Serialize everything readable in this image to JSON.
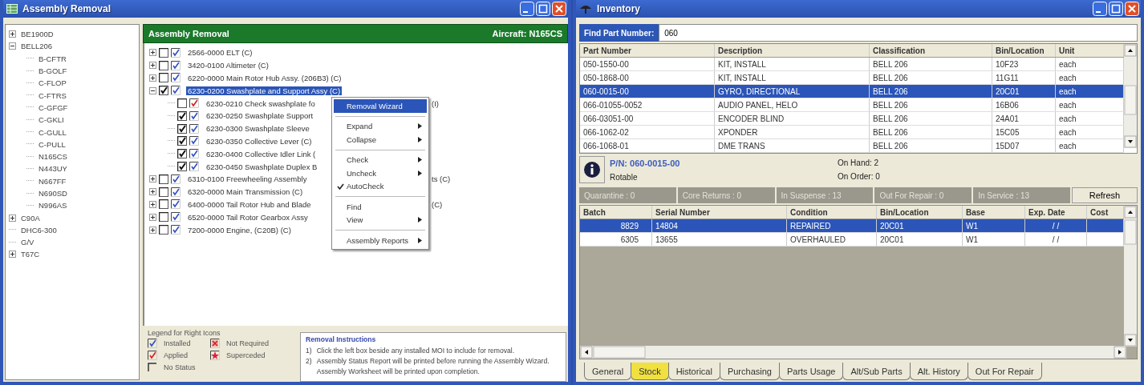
{
  "assembly_window": {
    "title": "Assembly Removal",
    "aircraft_tree": [
      {
        "label": "BE1900D",
        "expanded": false
      },
      {
        "label": "BELL206",
        "expanded": true,
        "children": [
          {
            "label": "B-CFTR"
          },
          {
            "label": "B-GOLF"
          },
          {
            "label": "C-FLOP"
          },
          {
            "label": "C-FTRS"
          },
          {
            "label": "C-GFGF"
          },
          {
            "label": "C-GKLI"
          },
          {
            "label": "C-GULL"
          },
          {
            "label": "C-PULL"
          },
          {
            "label": "N165CS"
          },
          {
            "label": "N443UY"
          },
          {
            "label": "N667FF"
          },
          {
            "label": "N690SD"
          },
          {
            "label": "N996AS"
          }
        ]
      },
      {
        "label": "C90A",
        "expanded": false
      },
      {
        "label": "DHC6-300"
      },
      {
        "label": "G/V"
      },
      {
        "label": "T67C",
        "expanded": false
      }
    ],
    "header": {
      "title": "Assembly Removal",
      "aircraft": "Aircraft: N165CS"
    },
    "assembly_tree": [
      {
        "text": "2566-0000   ELT  (C)",
        "expanded": false,
        "checked": false,
        "kind": "installed",
        "selected": false
      },
      {
        "text": "3420-0100   Altimeter  (C)",
        "expanded": false,
        "checked": false,
        "kind": "installed",
        "selected": false
      },
      {
        "text": "6220-0000   Main Rotor Hub Assy. (206B3)  (C)",
        "expanded": false,
        "checked": false,
        "kind": "installed",
        "selected": false
      },
      {
        "text": "6230-0200   Swashplate and Support Assy (C)",
        "expanded": true,
        "checked": true,
        "kind": "installed",
        "selected": true,
        "children": [
          {
            "text": "6230-0210   Check swashplate fo",
            "tail": "(I)",
            "checked": false,
            "kind": "applied",
            "selected": false
          },
          {
            "text": "6230-0250   Swashplate Support",
            "checked": true,
            "kind": "installed",
            "selected": false
          },
          {
            "text": "6230-0300   Swashplate Sleeve",
            "checked": true,
            "kind": "installed",
            "selected": false
          },
          {
            "text": "6230-0350   Collective Lever  (C)",
            "checked": true,
            "kind": "installed",
            "selected": false
          },
          {
            "text": "6230-0400   Collective Idler Link  (",
            "checked": true,
            "kind": "installed",
            "selected": false
          },
          {
            "text": "6230-0450   Swashplate Duplex B",
            "checked": true,
            "kind": "installed",
            "selected": false
          }
        ]
      },
      {
        "text": "6310-0100   Freewheeling Assembly",
        "tail": "ts  (C)",
        "expanded": false,
        "checked": false,
        "kind": "installed",
        "selected": false
      },
      {
        "text": "6320-0000   Main Transmission  (C)",
        "expanded": false,
        "checked": false,
        "kind": "installed",
        "selected": false
      },
      {
        "text": "6400-0000   Tail Rotor Hub and Blade",
        "tail": "(C)",
        "expanded": false,
        "checked": false,
        "kind": "installed",
        "selected": false
      },
      {
        "text": "6520-0000   Tail Rotor Gearbox Assy",
        "expanded": false,
        "checked": false,
        "kind": "installed",
        "selected": false
      },
      {
        "text": "7200-0000   Engine, (C20B)  (C)",
        "expanded": false,
        "checked": false,
        "kind": "installed",
        "selected": false
      }
    ],
    "context_menu": [
      {
        "label": "Removal Wizard",
        "selected": true,
        "submenu": false
      },
      {
        "kind": "separator"
      },
      {
        "label": "Expand",
        "selected": false,
        "submenu": true
      },
      {
        "label": "Collapse",
        "selected": false,
        "submenu": true
      },
      {
        "kind": "separator"
      },
      {
        "label": "Check",
        "selected": false,
        "submenu": true
      },
      {
        "label": "Uncheck",
        "selected": false,
        "submenu": true
      },
      {
        "label": "AutoCheck",
        "selected": false,
        "submenu": false,
        "checked": true
      },
      {
        "kind": "separator"
      },
      {
        "label": "Find",
        "selected": false,
        "submenu": false
      },
      {
        "label": "View",
        "selected": false,
        "submenu": true
      },
      {
        "kind": "separator"
      },
      {
        "label": "Assembly Reports",
        "selected": false,
        "submenu": true
      }
    ],
    "legend": {
      "title": "Legend for Right Icons",
      "items": [
        {
          "kind": "installed",
          "label": "Installed"
        },
        {
          "kind": "not_required",
          "label": "Not Required"
        },
        {
          "kind": "applied",
          "label": "Applied"
        },
        {
          "kind": "superceded",
          "label": "Superceded"
        },
        {
          "kind": "none",
          "label": "No Status"
        }
      ]
    },
    "instructions": {
      "title": "Removal Instructions",
      "steps": [
        {
          "number": "1)",
          "text": "Click the left box beside any installed MOI to include for removal."
        },
        {
          "number": "2)",
          "text": "Assembly Status Report will be printed before running the Assembly Wizard.  Assembly Worksheet will be printed upon completion."
        }
      ]
    }
  },
  "inventory_window": {
    "title": "Inventory",
    "find": {
      "label": "Find Part Number:",
      "value": "060"
    },
    "parts_table": {
      "columns": [
        "Part Number",
        "Description",
        "Classification",
        "Bin/Location",
        "Unit"
      ],
      "rows": [
        {
          "cells": [
            "050-1550-00",
            "KIT, INSTALL",
            "BELL 206",
            "10F23",
            "each"
          ],
          "selected": false
        },
        {
          "cells": [
            "050-1868-00",
            "KIT, INSTALL",
            "BELL 206",
            "11G11",
            "each"
          ],
          "selected": false
        },
        {
          "cells": [
            "060-0015-00",
            "GYRO, DIRECTIONAL",
            "BELL 206",
            "20C01",
            "each"
          ],
          "selected": true
        },
        {
          "cells": [
            "066-01055-0052",
            "AUDIO PANEL, HELO",
            "BELL 206",
            "16B06",
            "each"
          ],
          "selected": false
        },
        {
          "cells": [
            "066-03051-00",
            "ENCODER BLIND",
            "BELL 206",
            "24A01",
            "each"
          ],
          "selected": false
        },
        {
          "cells": [
            "066-1062-02",
            "XPONDER",
            "BELL 206",
            "15C05",
            "each"
          ],
          "selected": false
        },
        {
          "cells": [
            "066-1068-01",
            "DME TRANS",
            "BELL 206",
            "15D07",
            "each"
          ],
          "selected": false
        }
      ]
    },
    "part_info": {
      "part_number": "P/N:  060-0015-00",
      "type": "Rotable",
      "on_hand": "On Hand:  2",
      "on_order": "On Order:  0"
    },
    "status_counts": [
      "Quarantine :  0",
      "Core Returns :  0",
      "In Suspense :  13",
      "Out For Repair :  0",
      "In Service :  13"
    ],
    "refresh_button": "Refresh",
    "stock_table": {
      "columns": [
        "Batch",
        "Serial Number",
        "Condition",
        "Bin/Location",
        "Base",
        "Exp. Date",
        "Cost"
      ],
      "rows": [
        {
          "cells": [
            "8829",
            "14804",
            "REPAIRED",
            "20C01",
            "W1",
            "/  /"
          ],
          "selected": true
        },
        {
          "cells": [
            "6305",
            "13655",
            "OVERHAULED",
            "20C01",
            "W1",
            "/  /"
          ],
          "selected": false
        }
      ]
    },
    "tabs": [
      {
        "label": "General",
        "selected": false
      },
      {
        "label": "Stock",
        "selected": true
      },
      {
        "label": "Historical",
        "selected": false
      },
      {
        "label": "Purchasing",
        "selected": false
      },
      {
        "label": "Parts Usage",
        "selected": false
      },
      {
        "label": "Alt/Sub Parts",
        "selected": false
      },
      {
        "label": "Alt. History",
        "selected": false
      },
      {
        "label": "Out For Repair",
        "selected": false
      }
    ]
  }
}
